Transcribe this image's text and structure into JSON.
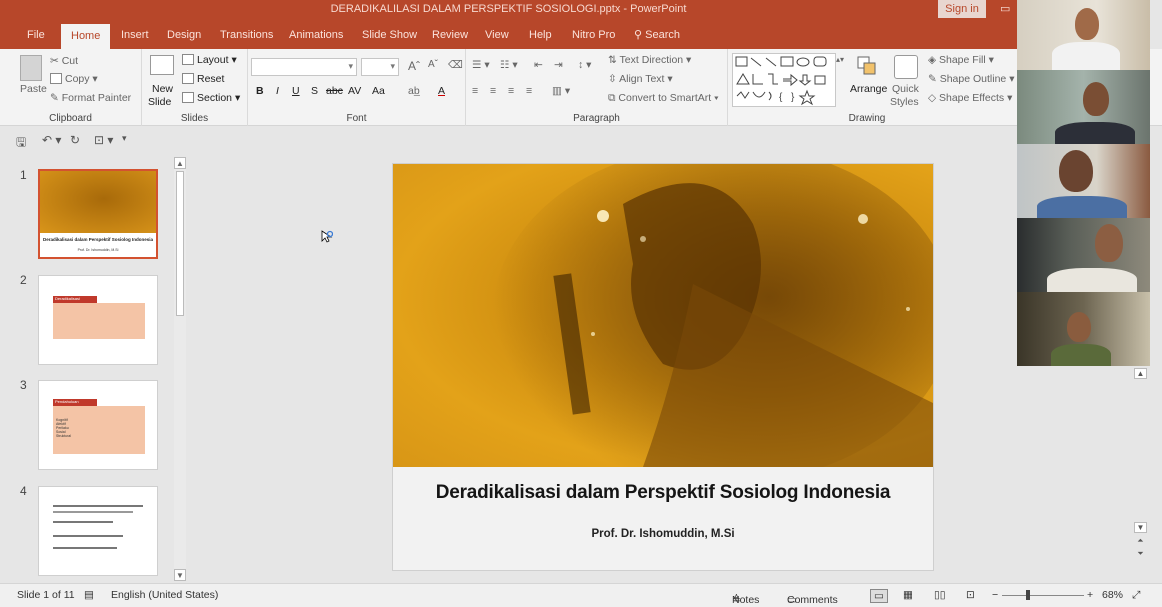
{
  "window": {
    "title": "DERADIKALILASI DALAM PERSPEKTIF SOSIOLOGI.pptx  -  PowerPoint",
    "signin": "Sign in"
  },
  "tabs": [
    "File",
    "Home",
    "Insert",
    "Design",
    "Transitions",
    "Animations",
    "Slide Show",
    "Review",
    "View",
    "Help",
    "Nitro Pro",
    "Search"
  ],
  "active_tab": "Home",
  "ribbon": {
    "clipboard": {
      "label": "Clipboard",
      "paste": "Paste",
      "cut": "Cut",
      "copy": "Copy",
      "format_painter": "Format Painter"
    },
    "slides": {
      "label": "Slides",
      "new_slide_1": "New",
      "new_slide_2": "Slide",
      "layout": "Layout",
      "reset": "Reset",
      "section": "Section"
    },
    "font": {
      "label": "Font",
      "bold": "B",
      "italic": "I",
      "underline": "U",
      "shadow": "S",
      "strike": "abc",
      "spacing": "AV",
      "case": "Aa",
      "color": "A"
    },
    "paragraph": {
      "label": "Paragraph",
      "text_direction": "Text Direction",
      "align_text": "Align Text",
      "convert": "Convert to SmartArt"
    },
    "drawing": {
      "label": "Drawing",
      "arrange": "Arrange",
      "quick_styles_1": "Quick",
      "quick_styles_2": "Styles",
      "shape_fill": "Shape Fill",
      "shape_outline": "Shape Outline",
      "shape_effects": "Shape Effects"
    }
  },
  "thumbnails": [
    {
      "num": "1",
      "title": "Deradikalisasi dalam Perspektif Sosiolog Indonesia",
      "sub": "Prof. Dr. Ishomuddin, M.Si"
    },
    {
      "num": "2",
      "heading": "Deradikalisasi"
    },
    {
      "num": "3",
      "heading": "Pendahuluan",
      "items": [
        "Kognitif",
        "Afektif",
        "Perilaku",
        "Sosial",
        "Struktural"
      ]
    },
    {
      "num": "4"
    }
  ],
  "slide": {
    "title": "Deradikalisasi dalam Perspektif Sosiolog Indonesia",
    "author": "Prof. Dr. Ishomuddin, M.Si"
  },
  "status": {
    "slide_count": "Slide 1 of 11",
    "language": "English (United States)",
    "notes": "Notes",
    "comments": "Comments",
    "zoom": "68%"
  },
  "colors": {
    "accent": "#b7472a",
    "photo_tint": "#d89616"
  }
}
